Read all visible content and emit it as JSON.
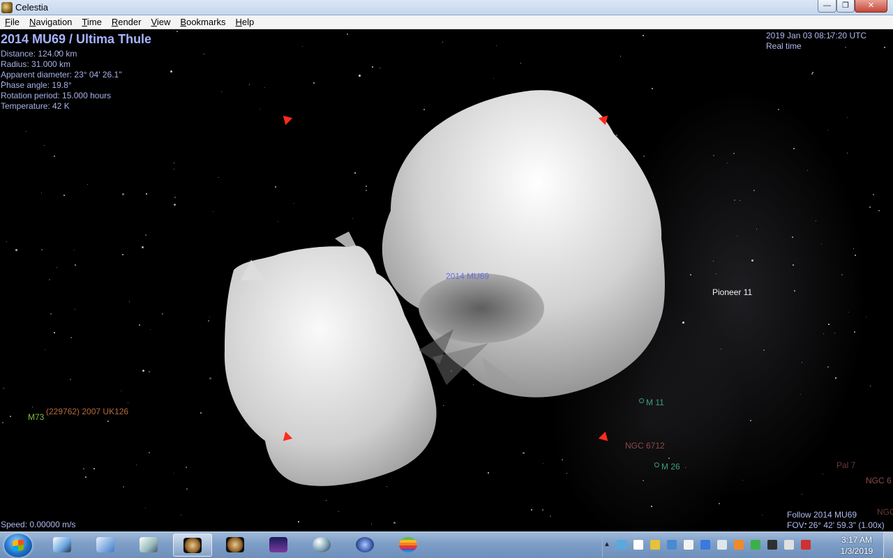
{
  "window": {
    "title": "Celestia"
  },
  "menu": {
    "items": [
      "File",
      "Navigation",
      "Time",
      "Render",
      "View",
      "Bookmarks",
      "Help"
    ]
  },
  "hud": {
    "object_title": "2014 MU69 /  Ultima Thule",
    "info_lines": [
      "Distance: 124.00 km",
      "Radius: 31.000 km",
      "Apparent diameter: 23° 04' 26.1\"",
      "Phase angle: 19.8°",
      "Rotation period: 15.000 hours",
      "Temperature: 42 K"
    ],
    "datetime": "2019 Jan 03 08:17:20 UTC",
    "time_mode": "Real time",
    "speed": "Speed: 0.00000 m/s",
    "follow": "Follow 2014 MU69",
    "fov": "FOV: 26° 42' 59.3\" (1.00x)"
  },
  "labels": {
    "mu69": "2014 MU69",
    "pioneer": "Pioneer 11",
    "m11": "M 11",
    "m26": "M 26",
    "ngc6712": "NGC 6712",
    "m73": "M73",
    "uk126": "(229762) 2007 UK126",
    "pal7": "Pal 7",
    "ngc6_partial": "NGC 6",
    "ngc_partial": "NGC"
  },
  "colors": {
    "marker": "#ff2b1a",
    "label_object": "#6a6ee0",
    "label_cluster_green": "#3aa078",
    "label_ngc": "#8a4a4a",
    "label_minor": "#b86a3a",
    "label_m73": "#7fbf3f"
  },
  "taskbar": {
    "time": "3:17 AM",
    "date": "1/3/2019",
    "apps": [
      "windows-start",
      "paint-app",
      "control-panel",
      "tools-app",
      "celestia-active",
      "celestia-2",
      "stellarium",
      "orb-app",
      "virus-app",
      "apple-app"
    ],
    "tray_icons": [
      "onedrive",
      "flag",
      "shield",
      "network-alt",
      "cloud",
      "dropbox",
      "volume",
      "app-orange",
      "app-green",
      "app-dark",
      "signal",
      "app-red"
    ]
  }
}
